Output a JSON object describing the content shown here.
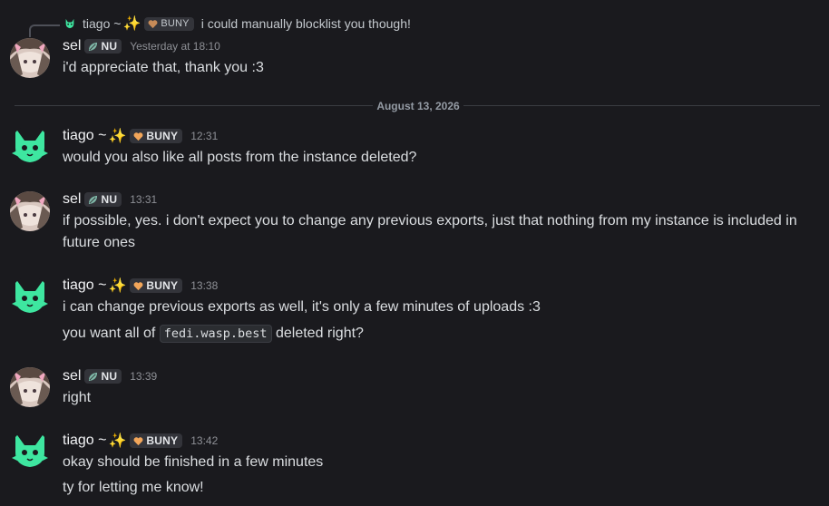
{
  "colors": {
    "background": "#1a1a1e",
    "text": "#dbdee1",
    "username": "#f2f3f5",
    "timestamp": "#8e9096",
    "role_tag_bg": "#33343a",
    "divider": "#3a3c42"
  },
  "reply": {
    "author": "tiago ~",
    "author_emoji": "✨",
    "author_tag": "BUNY",
    "author_tag_icon": "heart-icon",
    "text": "i could manually blocklist you though!"
  },
  "date_divider": "August 13, 2026",
  "messages": [
    {
      "author": "sel",
      "author_emoji": "",
      "tag": "NU",
      "tag_icon": "leaf-icon",
      "timestamp": "Yesterday at 18:10",
      "lines": [
        "i'd appreciate that, thank you :3"
      ]
    },
    {
      "author": "tiago ~",
      "author_emoji": "✨",
      "tag": "BUNY",
      "tag_icon": "heart-icon",
      "timestamp": "12:31",
      "lines": [
        "would you also like all posts from the instance deleted?"
      ]
    },
    {
      "author": "sel",
      "author_emoji": "",
      "tag": "NU",
      "tag_icon": "leaf-icon",
      "timestamp": "13:31",
      "lines": [
        "if possible, yes. i don't expect you to change any previous exports, just that nothing from my instance is included in future ones"
      ]
    },
    {
      "author": "tiago ~",
      "author_emoji": "✨",
      "tag": "BUNY",
      "tag_icon": "heart-icon",
      "timestamp": "13:38",
      "lines": [
        "i can change previous exports as well, it's only a few minutes of uploads :3",
        {
          "before": "you want all of ",
          "code": "fedi.wasp.best",
          "after": " deleted right?"
        }
      ]
    },
    {
      "author": "sel",
      "author_emoji": "",
      "tag": "NU",
      "tag_icon": "leaf-icon",
      "timestamp": "13:39",
      "lines": [
        "right"
      ]
    },
    {
      "author": "tiago ~",
      "author_emoji": "✨",
      "tag": "BUNY",
      "tag_icon": "heart-icon",
      "timestamp": "13:42",
      "lines": [
        "okay should be finished in a few minutes",
        "ty for letting me know!"
      ]
    }
  ]
}
